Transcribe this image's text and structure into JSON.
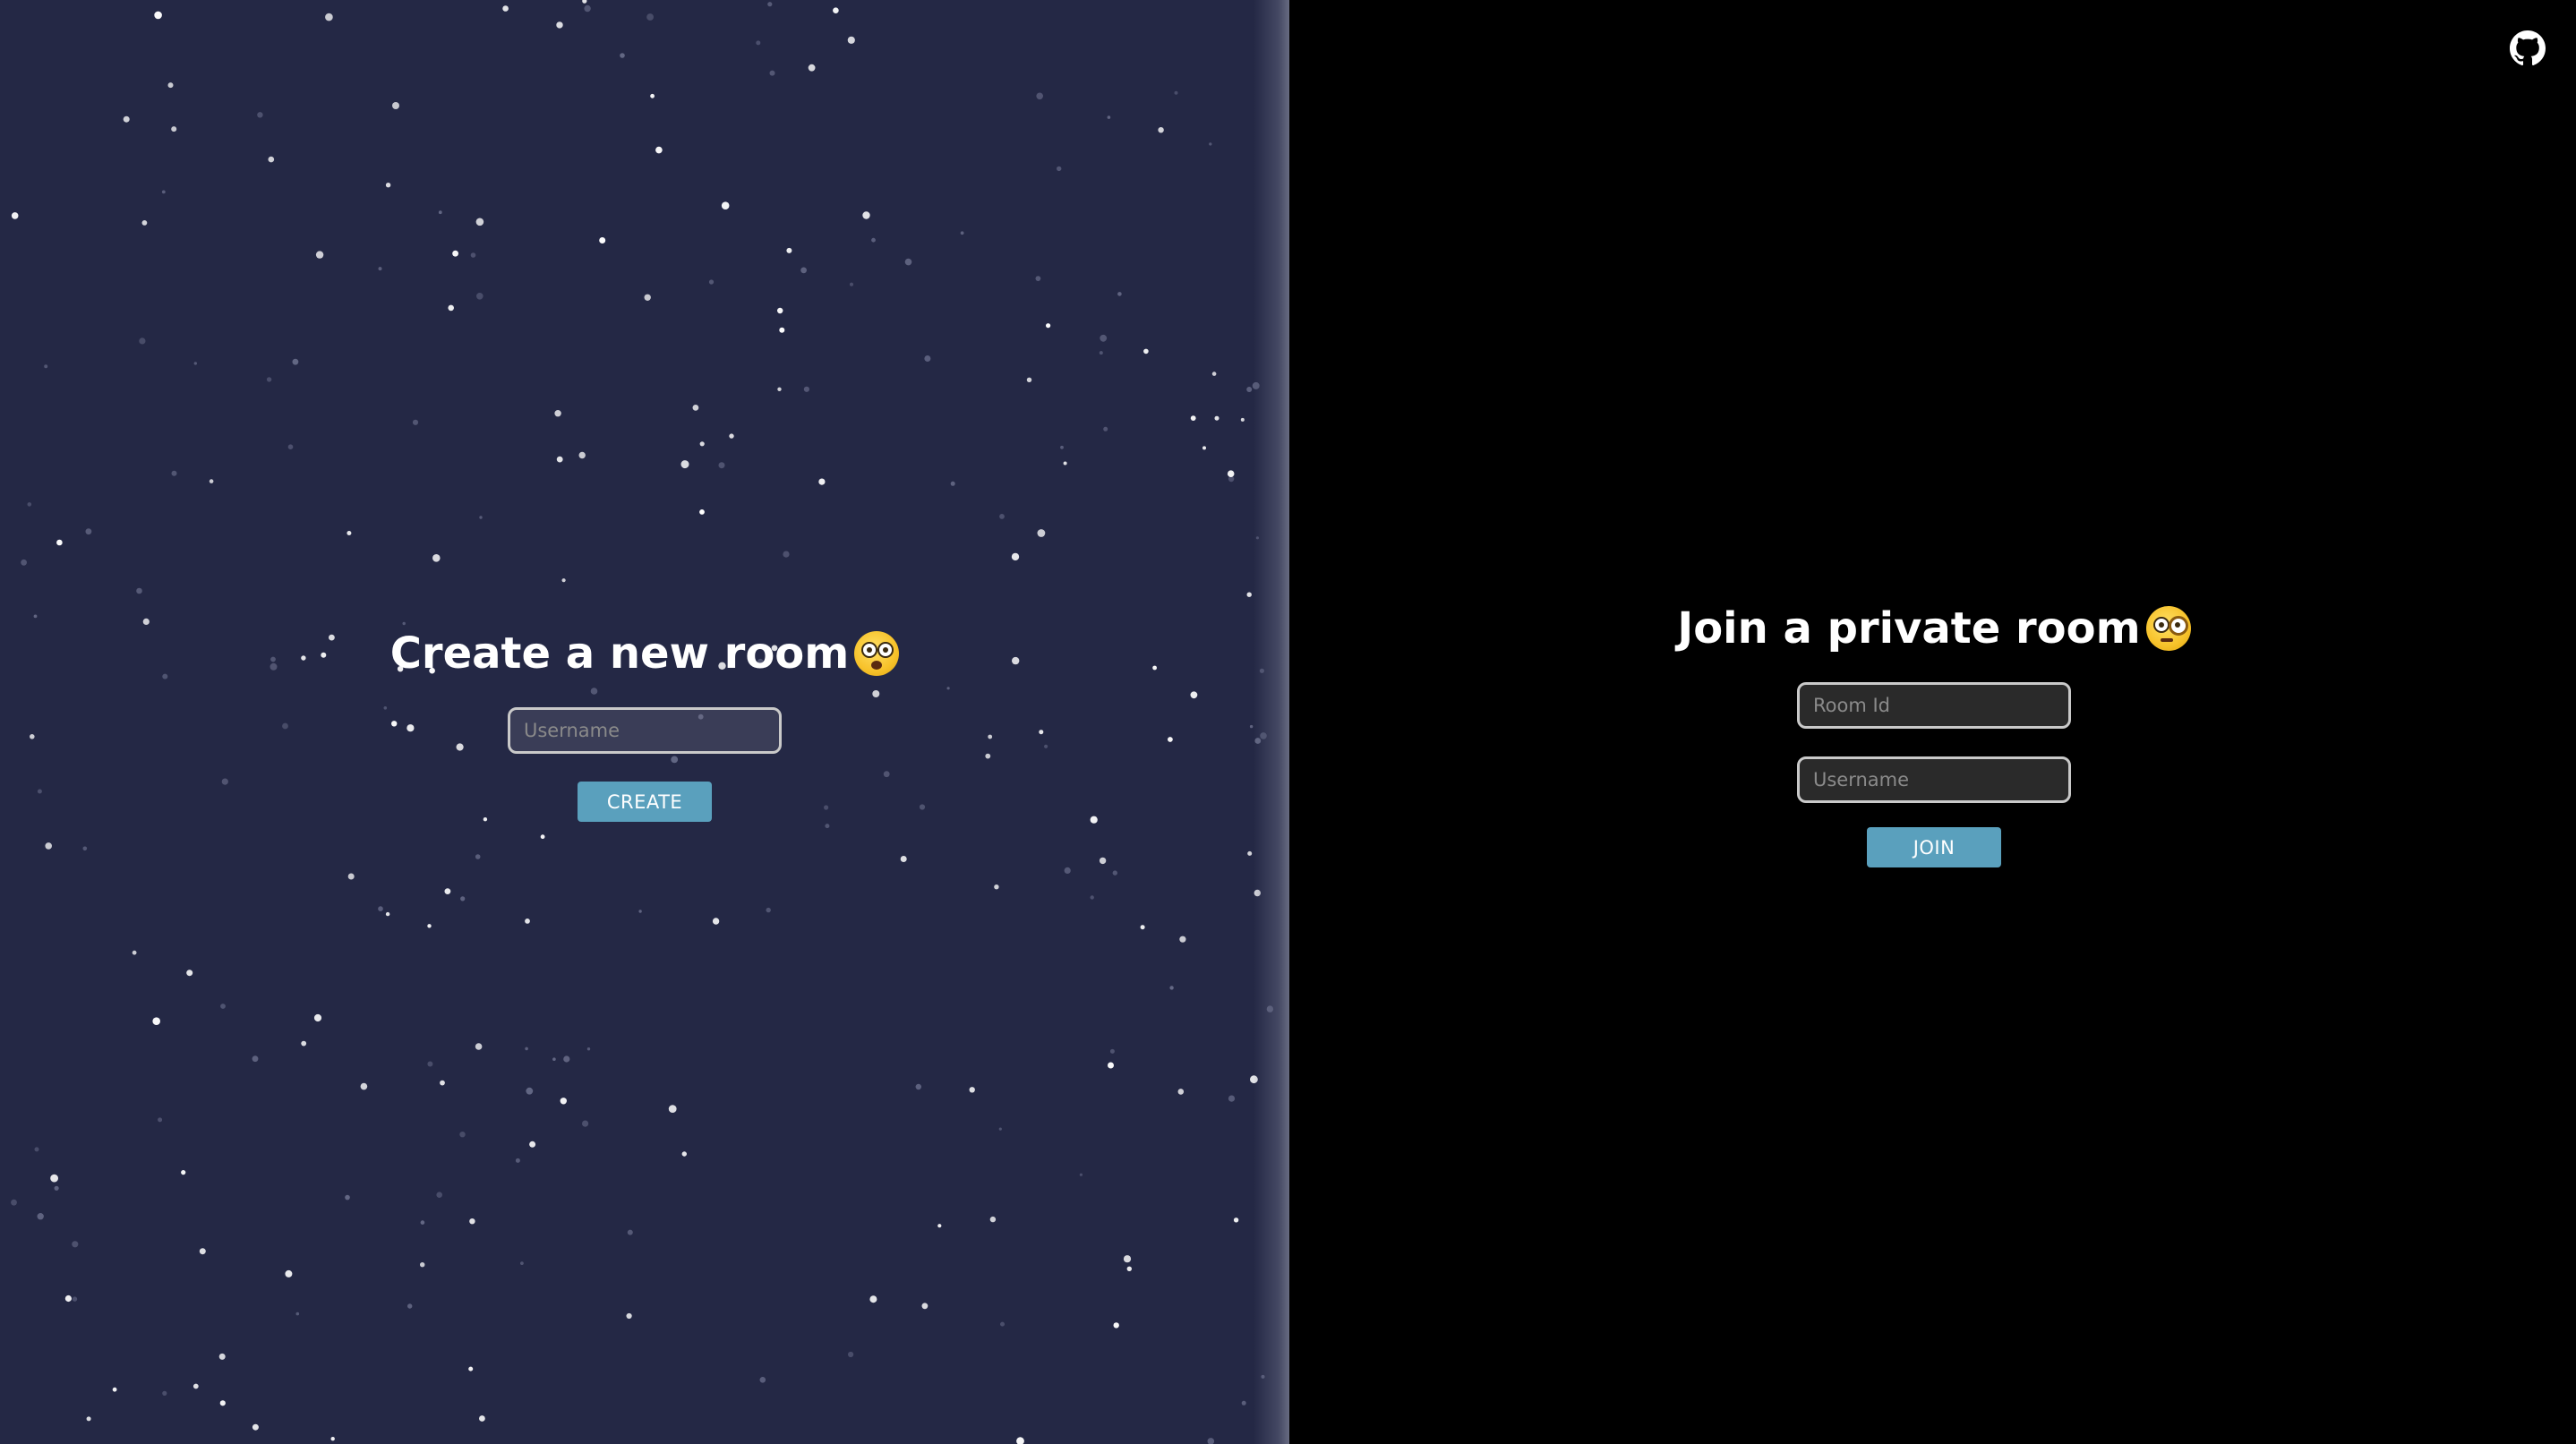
{
  "create_panel": {
    "heading": "Create a new room",
    "emoji_icon": "astonished-face-icon",
    "username_placeholder": "Username",
    "username_value": "",
    "button_label": "CREATE"
  },
  "join_panel": {
    "heading": "Join a private room",
    "emoji_icon": "face-with-monocle-icon",
    "room_id_placeholder": "Room Id",
    "room_id_value": "",
    "username_placeholder": "Username",
    "username_value": "",
    "button_label": "JOIN"
  },
  "header": {
    "github_icon": "github-icon"
  },
  "colors": {
    "left_background": "#242845",
    "right_background": "#000000",
    "button": "#5aa0bd",
    "text": "#ffffff"
  }
}
